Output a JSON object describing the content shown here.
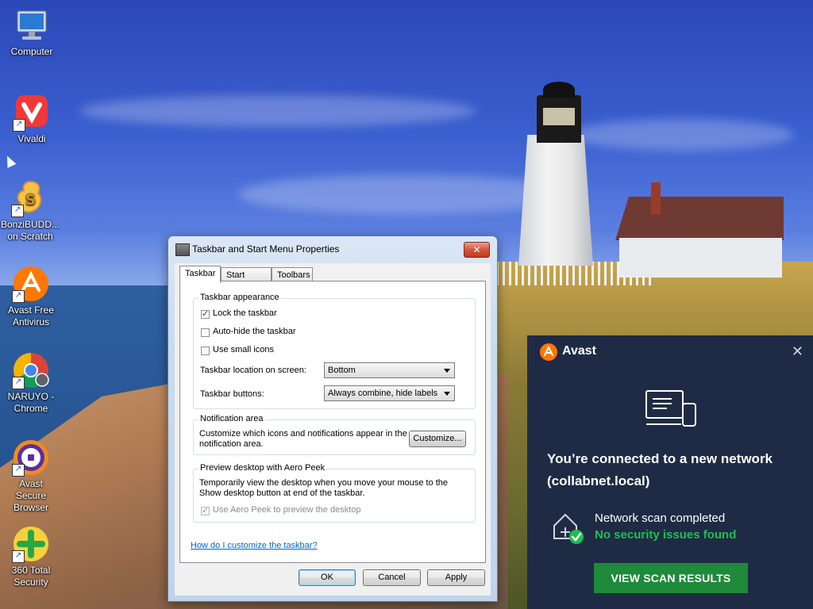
{
  "desktop": {
    "icons": [
      {
        "label": "Computer"
      },
      {
        "label": "Vivaldi"
      },
      {
        "label": "BonziBUDD... on Scratch"
      },
      {
        "label": "Avast Free Antivirus"
      },
      {
        "label": "NARUYO - Chrome"
      },
      {
        "label": "Avast Secure Browser"
      },
      {
        "label": "360 Total Security"
      }
    ]
  },
  "dialog": {
    "title": "Taskbar and Start Menu Properties",
    "close_glyph": "✕",
    "tabs": [
      {
        "label": "Taskbar",
        "active": true
      },
      {
        "label": "Start Menu",
        "active": false
      },
      {
        "label": "Toolbars",
        "active": false
      }
    ],
    "appearance": {
      "title": "Taskbar appearance",
      "lock": {
        "label": "Lock the taskbar",
        "checked": true
      },
      "autohide": {
        "label": "Auto-hide the taskbar",
        "checked": false
      },
      "small_icons": {
        "label": "Use small icons",
        "checked": false
      },
      "location_label": "Taskbar location on screen:",
      "location_value": "Bottom",
      "buttons_label": "Taskbar buttons:",
      "buttons_value": "Always combine, hide labels"
    },
    "notification": {
      "title": "Notification area",
      "text_line1": "Customize which icons and notifications appear in the",
      "text_line2": "notification area.",
      "button": "Customize..."
    },
    "aero_peek": {
      "title": "Preview desktop with Aero Peek",
      "text_line1": "Temporarily view the desktop when you move your mouse to the",
      "text_line2": "Show desktop button at end of the taskbar.",
      "checkbox_label": "Use Aero Peek to preview the desktop",
      "checked": true,
      "disabled": true
    },
    "help_link": "How do I customize the taskbar?",
    "buttons": {
      "ok": "OK",
      "cancel": "Cancel",
      "apply": "Apply"
    }
  },
  "toast": {
    "brand": "Avast",
    "close_glyph": "✕",
    "headline_line1": "You’re connected to a new network",
    "headline_line2": "(collabnet.local)",
    "scan_title": "Network scan completed",
    "scan_result": "No security issues found",
    "action_button": "VIEW SCAN RESULTS",
    "colors": {
      "background": "#1f2b44",
      "accent": "#ff7800",
      "success": "#1fbf4f",
      "button": "#1e8a3a"
    }
  }
}
